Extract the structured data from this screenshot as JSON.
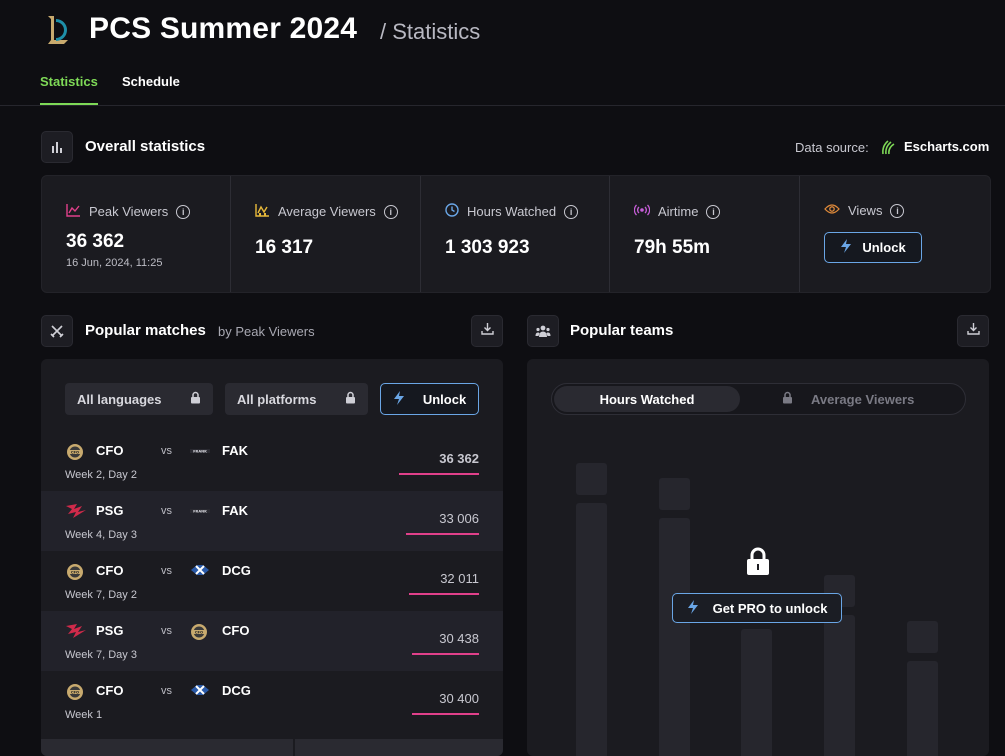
{
  "header": {
    "title": "PCS Summer 2024",
    "subtitle": "/ Statistics"
  },
  "tabs": [
    {
      "label": "Statistics",
      "active": true
    },
    {
      "label": "Schedule",
      "active": false
    }
  ],
  "overall": {
    "title": "Overall statistics",
    "data_source_label": "Data source:",
    "data_source_name": "Escharts.com",
    "stats": [
      {
        "label": "Peak Viewers",
        "value": "36 362",
        "date": "16 Jun, 2024, 11:25",
        "icon": "peak-chart-icon"
      },
      {
        "label": "Average Viewers",
        "value": "16 317",
        "icon": "average-chart-icon"
      },
      {
        "label": "Hours Watched",
        "value": "1 303 923",
        "icon": "clock-icon"
      },
      {
        "label": "Airtime",
        "value": "79h 55m",
        "icon": "broadcast-icon"
      },
      {
        "label": "Views",
        "unlock_label": "Unlock",
        "icon": "eye-icon"
      }
    ]
  },
  "matches": {
    "title": "Popular matches",
    "subtitle": "by Peak Viewers",
    "filters": {
      "languages": "All languages",
      "platforms": "All platforms",
      "unlock": "Unlock"
    },
    "rows": [
      {
        "team1": "CFO",
        "vs": "vs",
        "team2": "FAK",
        "week": "Week 2, Day 2",
        "value": "36 362",
        "share": 1.0
      },
      {
        "team1": "PSG",
        "vs": "vs",
        "team2": "FAK",
        "week": "Week 4, Day 3",
        "value": "33 006",
        "share": 0.91
      },
      {
        "team1": "CFO",
        "vs": "vs",
        "team2": "DCG",
        "week": "Week 7, Day 2",
        "value": "32 011",
        "share": 0.88
      },
      {
        "team1": "PSG",
        "vs": "vs",
        "team2": "CFO",
        "week": "Week 7, Day 3",
        "value": "30 438",
        "share": 0.84
      },
      {
        "team1": "CFO",
        "vs": "vs",
        "team2": "DCG",
        "week": "Week 1",
        "value": "30 400",
        "share": 0.84
      }
    ]
  },
  "teams": {
    "title": "Popular teams",
    "toggle_active": "Hours Watched",
    "toggle_inactive": "Average Viewers",
    "pro_label": "Get PRO to unlock"
  },
  "colors": {
    "accent_green": "#7ed957",
    "unlock_blue": "#6aa6e6",
    "bar_pink": "#e0408a",
    "panel_bg": "#1b1b20",
    "page_bg": "#0e0e12"
  }
}
